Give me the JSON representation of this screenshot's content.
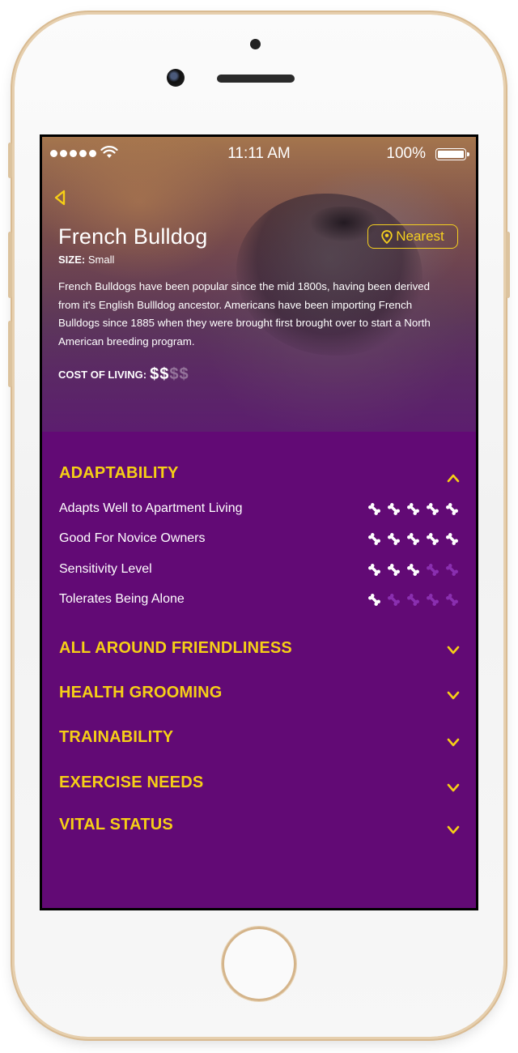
{
  "status_bar": {
    "time": "11:11 AM",
    "battery": "100%"
  },
  "breed": {
    "name": "French Bulldog",
    "size_label": "SIZE:",
    "size_value": "Small",
    "nearest_label": "Nearest",
    "description": "French Bulldogs have been popular since the mid 1800s, having been derived from it's English Bullldog ancestor. Americans have been importing French Bulldogs since 1885 when they were brought first brought over to start a North American breeding program.",
    "cost_label": "COST OF LIVING:",
    "cost_level": 2,
    "cost_max": 4
  },
  "colors": {
    "accent": "#f6cf16",
    "background": "#620a75",
    "bone_on": "#ffffff",
    "bone_off": "#8a2fb0"
  },
  "sections": [
    {
      "title": "ADAPTABILITY",
      "expanded": true,
      "traits": [
        {
          "label": "Adapts Well to Apartment Living",
          "rating": 5,
          "max": 5
        },
        {
          "label": "Good For Novice Owners",
          "rating": 5,
          "max": 5
        },
        {
          "label": "Sensitivity Level",
          "rating": 3,
          "max": 5
        },
        {
          "label": "Tolerates Being Alone",
          "rating": 1,
          "max": 5
        }
      ]
    },
    {
      "title": "ALL AROUND FRIENDLINESS",
      "expanded": false
    },
    {
      "title": "HEALTH GROOMING",
      "expanded": false
    },
    {
      "title": "TRAINABILITY",
      "expanded": false
    },
    {
      "title": "EXERCISE NEEDS",
      "expanded": false
    },
    {
      "title": "VITAL STATUS",
      "expanded": false
    }
  ],
  "icons": {
    "back": "chevron-left-icon",
    "location": "location-pin-icon",
    "expand": "chevron-down-icon",
    "collapse": "chevron-up-icon",
    "rating": "bone-icon"
  }
}
